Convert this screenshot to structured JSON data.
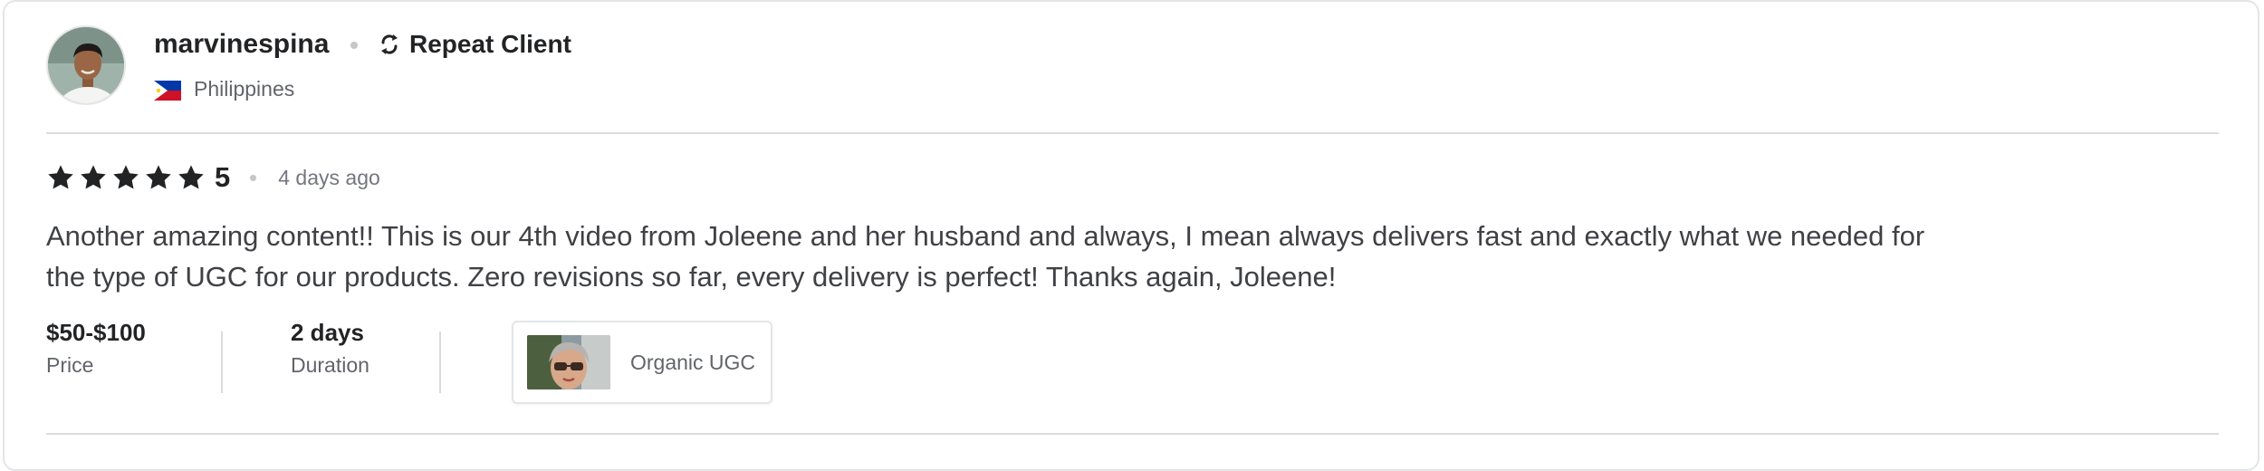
{
  "reviewer": {
    "username": "marvinespina",
    "badge_label": "Repeat Client",
    "badge_icon": "repeat-icon",
    "country": "Philippines",
    "flag_icon": "philippines-flag-icon",
    "avatar_icon": "user-avatar"
  },
  "review": {
    "stars": 5,
    "rating": "5",
    "time_ago": "4 days ago",
    "text": "Another amazing content!! This is our 4th video from Joleene and her husband and always, I mean always delivers fast and exactly what we needed for the type of UGC for our products. Zero revisions so far, every delivery is perfect! Thanks again, Joleene!"
  },
  "meta": {
    "price_value": "$50-$100",
    "price_label": "Price",
    "duration_value": "2 days",
    "duration_label": "Duration"
  },
  "service": {
    "name": "Organic UGC",
    "thumbnail_icon": "gig-thumbnail-image"
  },
  "colors": {
    "text_primary": "#222325",
    "text_secondary": "#62646a",
    "star": "#222325",
    "divider": "#dadbdd"
  }
}
